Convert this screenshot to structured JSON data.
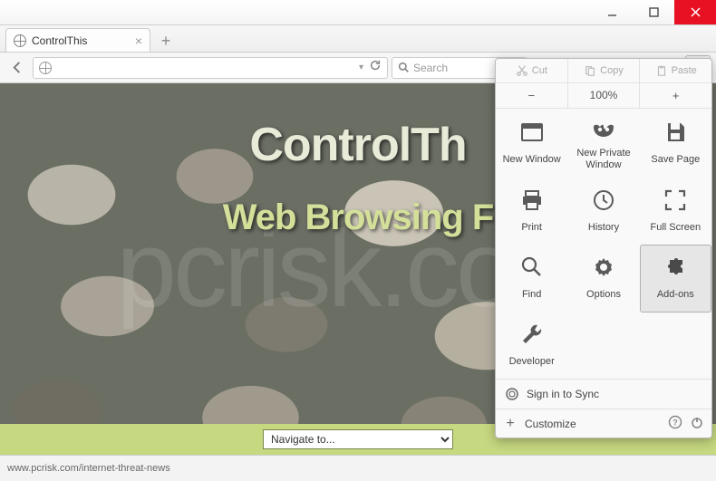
{
  "window": {
    "tab_title": "ControlThis"
  },
  "navbar": {
    "search_placeholder": "Search"
  },
  "page": {
    "heading": "ControlTh",
    "subheading": "Web Browsing F",
    "watermark": "pcrisk.com",
    "nav_select": "Navigate to..."
  },
  "statusbar": {
    "text": "www.pcrisk.com/internet-threat-news"
  },
  "menu": {
    "edit": {
      "cut": "Cut",
      "copy": "Copy",
      "paste": "Paste"
    },
    "zoom": {
      "minus": "−",
      "level": "100%",
      "plus": "+"
    },
    "items": {
      "new_window": "New Window",
      "new_private": "New Private Window",
      "save_page": "Save Page",
      "print": "Print",
      "history": "History",
      "fullscreen": "Full Screen",
      "find": "Find",
      "options": "Options",
      "addons": "Add-ons",
      "developer": "Developer"
    },
    "signin": "Sign in to Sync",
    "customize": "Customize"
  }
}
